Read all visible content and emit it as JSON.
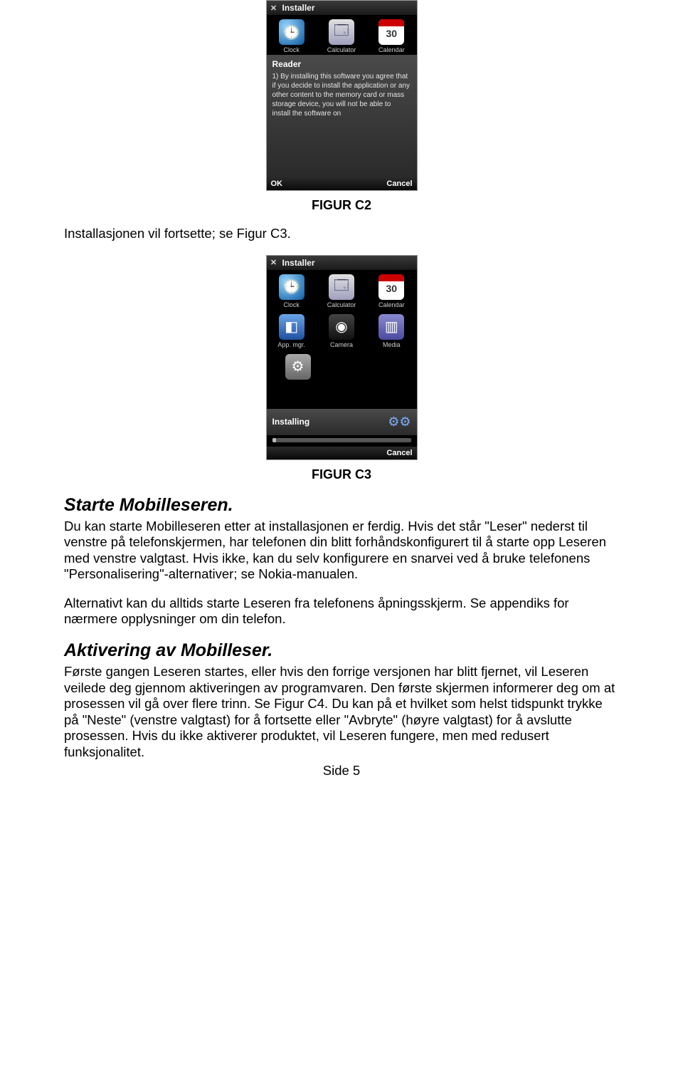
{
  "phone1": {
    "title": "Installer",
    "icons": [
      {
        "name": "clock-icon",
        "label": "Clock",
        "glyph": "🕒"
      },
      {
        "name": "calculator-icon",
        "label": "Calculator",
        "glyph": "🗔"
      },
      {
        "name": "calendar-icon",
        "label": "Calendar",
        "glyph": "30"
      }
    ],
    "reader_title": "Reader",
    "reader_body": "1) By installing this software you agree that if you decide to install the application or any other content to the memory card or mass storage device, you will not be able to install the software on",
    "ok": "OK",
    "cancel": "Cancel"
  },
  "caption1": "FIGUR C2",
  "para1": "Installasjonen vil fortsette; se Figur C3.",
  "phone2": {
    "title": "Installer",
    "icons_row1": [
      {
        "name": "clock-icon",
        "label": "Clock",
        "glyph": "🕒"
      },
      {
        "name": "calculator-icon",
        "label": "Calculator",
        "glyph": "🗔"
      },
      {
        "name": "calendar-icon",
        "label": "Calendar",
        "glyph": "30"
      }
    ],
    "icons_row2": [
      {
        "name": "app-manager-icon",
        "label": "App. mgr.",
        "glyph": "◧"
      },
      {
        "name": "camera-icon",
        "label": "Camera",
        "glyph": "◉"
      },
      {
        "name": "media-icon",
        "label": "Media",
        "glyph": "▥"
      }
    ],
    "icons_row3": [
      {
        "name": "settings-icon",
        "label": "",
        "glyph": "⚙"
      }
    ],
    "installing_label": "Installing",
    "cancel": "Cancel"
  },
  "caption2": "FIGUR C3",
  "section1_title": "Starte Mobilleseren.",
  "section1_p1": "Du kan starte Mobilleseren etter at installasjonen er ferdig. Hvis det står \"Leser\" nederst til venstre på telefonskjermen, har telefonen din blitt forhåndskonfigurert til å starte opp Leseren med venstre valgtast. Hvis ikke, kan du selv konfigurere en snarvei ved å bruke telefonens \"Personalisering\"-alternativer; se Nokia-manualen.",
  "section1_p2": "Alternativt kan du alltids starte Leseren fra telefonens åpningsskjerm. Se appendiks for nærmere opplysninger om din telefon.",
  "section2_title": "Aktivering av Mobilleser.",
  "section2_p1": "Første gangen Leseren startes, eller hvis den forrige versjonen har blitt fjernet, vil Leseren veilede deg gjennom aktiveringen av programvaren. Den første skjermen informerer deg om at prosessen vil gå over flere trinn. Se Figur C4. Du kan på et hvilket som helst tidspunkt trykke på \"Neste\" (venstre valgtast) for å fortsette eller \"Avbryte\" (høyre valgtast) for å avslutte prosessen. Hvis du ikke aktiverer produktet, vil Leseren fungere, men med redusert funksjonalitet.",
  "page_footer": "Side 5"
}
